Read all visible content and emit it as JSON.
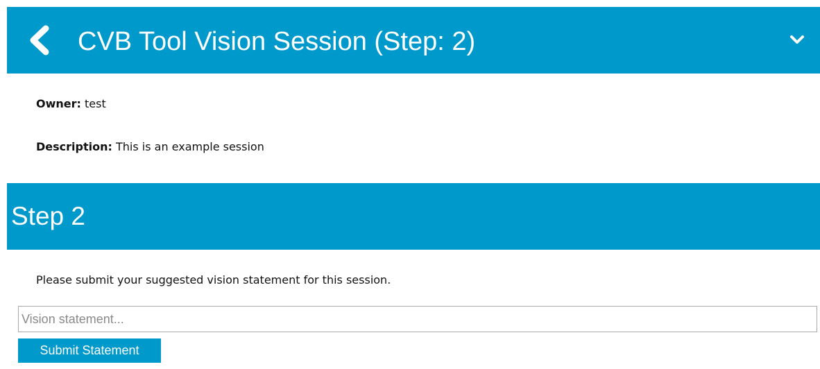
{
  "header": {
    "title": "CVB Tool Vision Session (Step: 2)",
    "back_icon": "chevron-left-icon",
    "collapse_icon": "chevron-down-icon",
    "background_color": "#0099cc"
  },
  "session": {
    "owner_label": "Owner:",
    "owner_value": "test",
    "description_label": "Description:",
    "description_value": "This is an example session"
  },
  "step": {
    "title": "Step 2",
    "instruction": "Please submit your suggested vision statement for this session.",
    "input": {
      "value": "",
      "placeholder": "Vision statement..."
    },
    "submit_label": "Submit Statement"
  }
}
